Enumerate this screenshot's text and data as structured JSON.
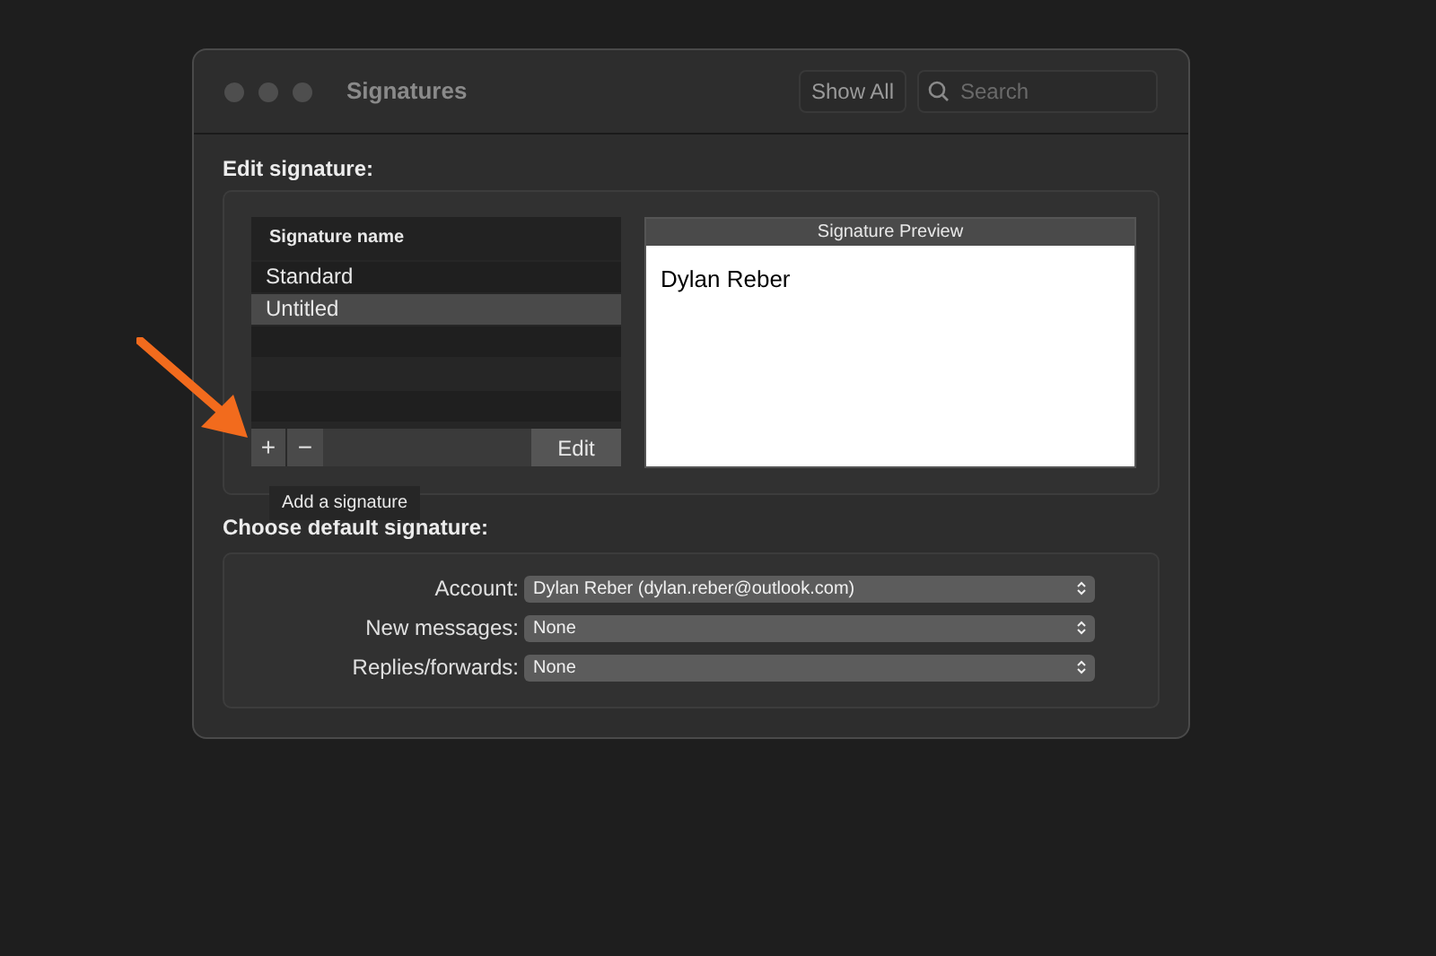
{
  "window": {
    "title": "Signatures"
  },
  "toolbar": {
    "show_all": "Show All",
    "search": {
      "placeholder": "Search"
    }
  },
  "edit_section": {
    "title": "Edit signature:",
    "list": {
      "header": "Signature name",
      "rows": [
        {
          "label": "Standard",
          "selected": false
        },
        {
          "label": "Untitled",
          "selected": true
        }
      ]
    },
    "buttons": {
      "add": "+",
      "remove": "−",
      "edit": "Edit"
    },
    "tooltip": "Add a signature",
    "preview": {
      "header": "Signature Preview",
      "text": "Dylan Reber"
    }
  },
  "default_section": {
    "title": "Choose default signature:",
    "fields": [
      {
        "label": "Account:",
        "value": "Dylan Reber (dylan.reber@outlook.com)"
      },
      {
        "label": "New messages:",
        "value": "None"
      },
      {
        "label": "Replies/forwards:",
        "value": "None"
      }
    ]
  }
}
